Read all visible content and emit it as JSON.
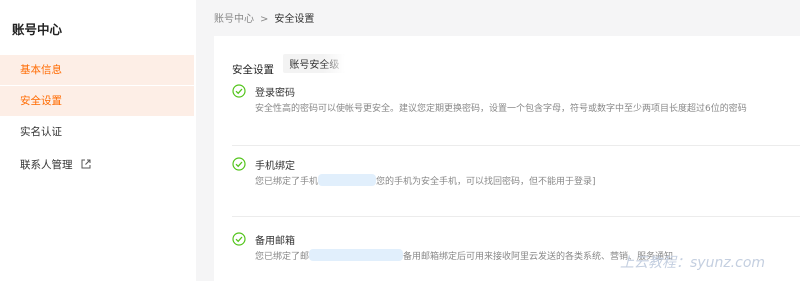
{
  "sidebar": {
    "title": "账号中心",
    "items": [
      {
        "label": "基本信息",
        "active": true
      },
      {
        "label": "安全设置",
        "active": true
      },
      {
        "label": "实名认证",
        "active": false
      },
      {
        "label": "联系人管理",
        "active": false,
        "icon": "external-link-icon"
      }
    ]
  },
  "breadcrumb": {
    "parent": "账号中心",
    "separator": ">",
    "current": "安全设置"
  },
  "panel": {
    "title": "安全设置",
    "tab": "账号安全级",
    "items": [
      {
        "title": "登录密码",
        "icon": "check-circle-icon",
        "desc": "安全性高的密码可以使帐号更安全。建议您定期更换密码，设置一个包含字母，符号或数字中至少两项目长度超过6位的密码"
      },
      {
        "title": "手机绑定",
        "icon": "check-circle-icon",
        "desc_before": "您已绑定了手机",
        "desc_after": "您的手机为安全手机，可以找回密码，但不能用于登录]"
      },
      {
        "title": "备用邮箱",
        "icon": "check-circle-icon",
        "desc_before": "您已绑定了邮",
        "desc_after": "备用邮箱绑定后可用来接收阿里云发送的各类系统、营销、服务通知"
      }
    ]
  },
  "watermark": "上云教程：syunz.com",
  "colors": {
    "accent": "#ff6a00",
    "active_bg": "#fdeee6",
    "success": "#52c41a"
  }
}
